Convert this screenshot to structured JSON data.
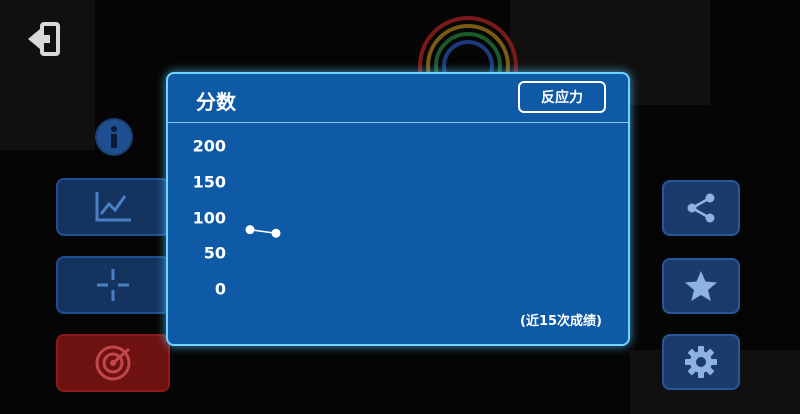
{
  "dialog": {
    "title": "分数",
    "mode_button": "反应力",
    "footnote": "(近15次成绩)"
  },
  "chart_data": {
    "type": "line",
    "x": [
      1,
      2
    ],
    "values": [
      83,
      78
    ],
    "yticks": [
      "200",
      "150",
      "100",
      "50",
      "0"
    ],
    "ylim": [
      0,
      200
    ],
    "grid": false
  },
  "colors": {
    "dialog_bg": "#0e5aa7",
    "dialog_border": "#6fd3ff",
    "accent_red": "#6e1111"
  },
  "icons": {
    "exit": "exit-icon",
    "info": "info-icon",
    "chart": "line-chart-icon",
    "crosshair": "crosshair-icon",
    "target": "target-icon",
    "share": "share-icon",
    "star": "star-icon",
    "settings": "gear-icon"
  }
}
